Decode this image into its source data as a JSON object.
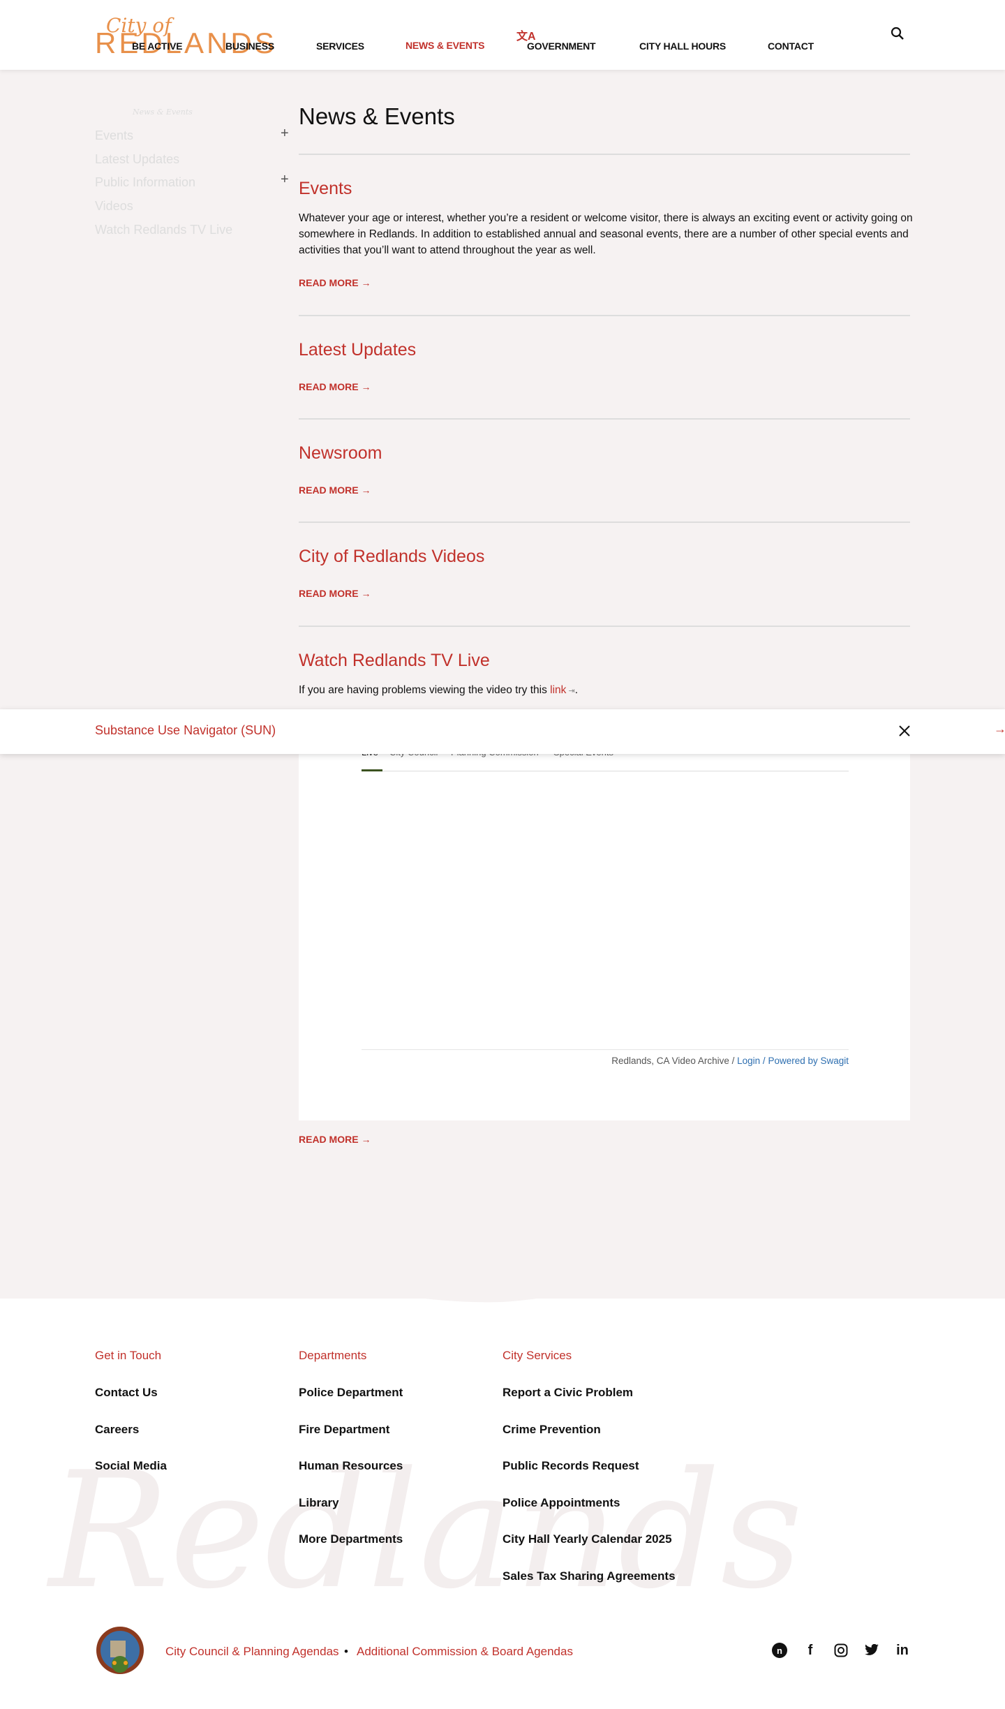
{
  "header": {
    "logo_script": "City of",
    "logo_main": "REDLANDS",
    "nav": [
      "BE ACTIVE",
      "BUSINESS",
      "SERVICES",
      "NEWS & EVENTS",
      "GOVERNMENT",
      "CITY HALL HOURS",
      "CONTACT"
    ],
    "translate_icon": "文A"
  },
  "sidebar": {
    "title": "News & Events",
    "items": [
      "Events",
      "Latest Updates",
      "Public Information",
      "Videos",
      "Watch Redlands TV Live"
    ]
  },
  "main": {
    "title": "News & Events",
    "read_more": "READ MORE →",
    "sections": [
      {
        "title": "Events",
        "body": "Whatever your age or interest, whether you’re a resident or welcome visitor, there is always an exciting event or activity going on somewhere in Redlands. In addition to established annual and seasonal events, there are a number of other special events and activities that you’ll want to attend throughout the year as well."
      },
      {
        "title": "Latest Updates"
      },
      {
        "title": "Newsroom"
      },
      {
        "title": "City of Redlands Videos"
      },
      {
        "title": "Watch Redlands TV Live",
        "body_before": "If you are having problems viewing the video try this ",
        "link": "link",
        "body_after": "."
      }
    ]
  },
  "banner": {
    "text": "Substance Use Navigator (SUN)"
  },
  "video": {
    "tabs": [
      "Live",
      "City Council",
      "Planning Commission",
      "Special Events"
    ],
    "footer_text": "Redlands, CA Video Archive / ",
    "login": "Login",
    "sep": " / ",
    "powered": "Powered by Swagit"
  },
  "footer": {
    "watermark": "Redlands",
    "columns": [
      {
        "heading": "Get in Touch",
        "items": [
          "Contact Us",
          "Careers",
          "Social Media"
        ]
      },
      {
        "heading": "Departments",
        "items": [
          "Police Department",
          "Fire Department",
          "Human Resources",
          "Library",
          "More Departments"
        ]
      },
      {
        "heading": "City Services",
        "items": [
          "Report a Civic Problem",
          "Crime Prevention",
          "Public Records Request",
          "Police Appointments",
          "City Hall Yearly Calendar 2025",
          "Sales Tax Sharing Agreements"
        ]
      }
    ],
    "bottom_links": [
      "City Council & Planning Agendas",
      "Additional Commission & Board Agendas"
    ],
    "dot": "•",
    "social": [
      "nextdoor",
      "facebook",
      "instagram",
      "twitter",
      "linkedin"
    ]
  },
  "colors": {
    "accent": "#c1312b",
    "logo": "#e8904a",
    "bg": "#f6f2f2"
  }
}
